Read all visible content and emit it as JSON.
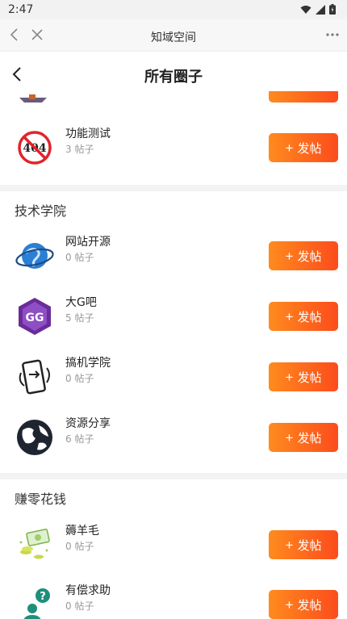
{
  "status_bar": {
    "time": "2:47"
  },
  "browser": {
    "title": "知域空间"
  },
  "header": {
    "title": "所有圈子"
  },
  "post_label": "发帖",
  "post_plus": "+",
  "top_item": {
    "name": "功能测试",
    "count": "3 帖子",
    "icon": "404-icon"
  },
  "sections": [
    {
      "title": "技术学院",
      "items": [
        {
          "name": "网站开源",
          "count": "0 帖子",
          "icon": "globe-ring-icon"
        },
        {
          "name": "大G吧",
          "count": "5 帖子",
          "icon": "game-guardian-icon"
        },
        {
          "name": "搞机学院",
          "count": "0 帖子",
          "icon": "phone-hand-icon"
        },
        {
          "name": "资源分享",
          "count": "6 帖子",
          "icon": "earth-icon"
        }
      ]
    },
    {
      "title": "赚零花钱",
      "items": [
        {
          "name": "薅羊毛",
          "count": "0 帖子",
          "icon": "money-icon"
        },
        {
          "name": "有偿求助",
          "count": "0 帖子",
          "icon": "help-person-icon"
        }
      ]
    }
  ],
  "colors": {
    "accent_start": "#ff8b1e",
    "accent_end": "#fb4c1c",
    "divider": "#f3f3f3"
  }
}
